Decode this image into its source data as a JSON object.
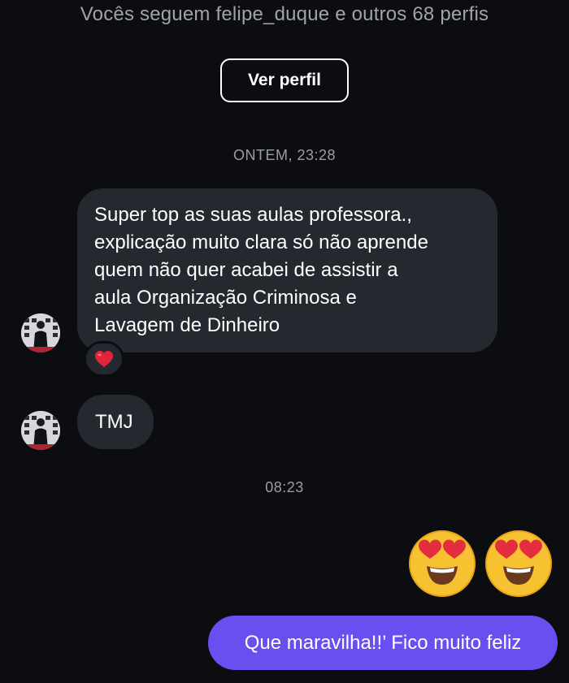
{
  "header": {
    "mutual_followers_text": "Vocês seguem felipe_duque e outros 68 perfis",
    "view_profile_label": "Ver perfil"
  },
  "timestamps": [
    "ONTEM, 23:28",
    "08:23"
  ],
  "messages": {
    "incoming": [
      {
        "lines": [
          "Super top as suas aulas professora.,",
          "explicação muito clara só não aprende",
          "quem não quer acabei de assistir a",
          "aula Organização Criminosa e",
          "Lavagem de Dinheiro"
        ],
        "reaction": "heart-icon"
      },
      {
        "text": "TMJ"
      }
    ],
    "outgoing": [
      {
        "emojis": [
          "heart-eyes-emoji",
          "heart-eyes-emoji"
        ]
      },
      {
        "text": "Que maravilha!!’ Fico muito feliz"
      }
    ]
  },
  "colors": {
    "background": "#0c0d11",
    "incoming_bubble": "#262830",
    "outgoing_bubble": "#6b4ef0",
    "secondary_text": "#a0a3aa",
    "heart": "#e0243a"
  }
}
